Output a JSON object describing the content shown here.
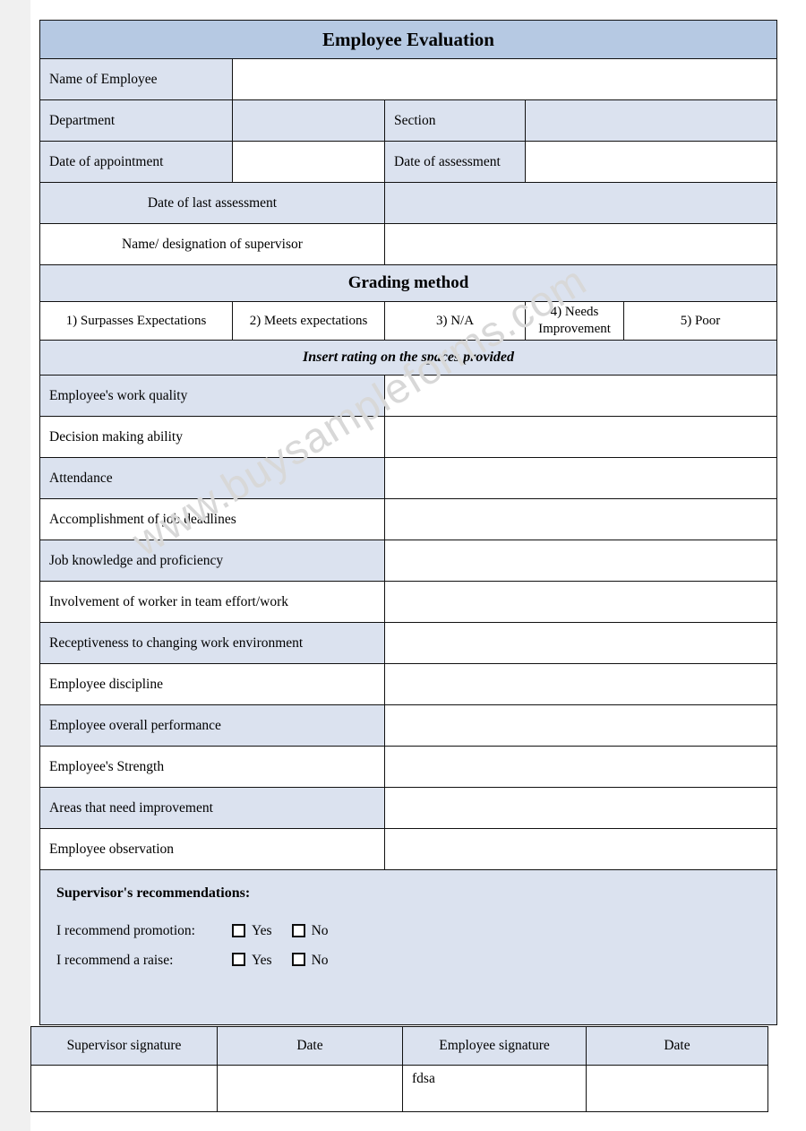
{
  "document": {
    "title": "Employee Evaluation",
    "watermark": "www.buysampleforms.com"
  },
  "colors": {
    "header_fill": "#b6c9e3",
    "row_tint": "#dbe2ef",
    "border": "#111111",
    "watermark": "#d8d8d8"
  },
  "identity": {
    "name_label": "Name of Employee",
    "name_value": "",
    "department_label": "Department",
    "department_value": "",
    "section_label": "Section",
    "section_value": "",
    "date_of_appointment_label": "Date of appointment",
    "date_of_appointment_value": "",
    "date_of_assessment_label": "Date of assessment",
    "date_of_assessment_value": "",
    "date_of_last_assessment_label": "Date of last assessment",
    "date_of_last_assessment_value": "",
    "supervisor_label": "Name/ designation of supervisor",
    "supervisor_value": ""
  },
  "grading": {
    "heading": "Grading method",
    "scale": [
      "1) Surpasses Expectations",
      "2) Meets expectations",
      "3) N/A",
      "4) Needs Improvement",
      "5) Poor"
    ],
    "instruction": "Insert rating on the spaces provided"
  },
  "criteria": [
    {
      "label": "Employee's work quality",
      "rating": ""
    },
    {
      "label": "Decision making ability",
      "rating": ""
    },
    {
      "label": "Attendance",
      "rating": ""
    },
    {
      "label": "Accomplishment of job deadlines",
      "rating": ""
    },
    {
      "label": "Job knowledge and proficiency",
      "rating": ""
    },
    {
      "label": "Involvement of worker in team effort/work",
      "rating": ""
    },
    {
      "label": "Receptiveness to changing work environment",
      "rating": ""
    },
    {
      "label": "Employee discipline",
      "rating": ""
    },
    {
      "label": "Employee overall performance",
      "rating": ""
    },
    {
      "label": "Employee's Strength",
      "rating": ""
    },
    {
      "label": "Areas that need improvement",
      "rating": ""
    },
    {
      "label": "Employee observation",
      "rating": ""
    }
  ],
  "recommendations": {
    "title": "Supervisor's recommendations:",
    "promotion_label": "I recommend promotion:",
    "promotion_yes": "Yes",
    "promotion_no": "No",
    "promotion_yes_checked": false,
    "promotion_no_checked": false,
    "raise_label": "I recommend a raise:",
    "raise_yes": "Yes",
    "raise_no": "No",
    "raise_yes_checked": false,
    "raise_no_checked": false
  },
  "signatures": {
    "headers": [
      "Supervisor signature",
      "Date",
      "Employee signature",
      "Date"
    ],
    "values": [
      "",
      "",
      "fdsa",
      ""
    ]
  }
}
